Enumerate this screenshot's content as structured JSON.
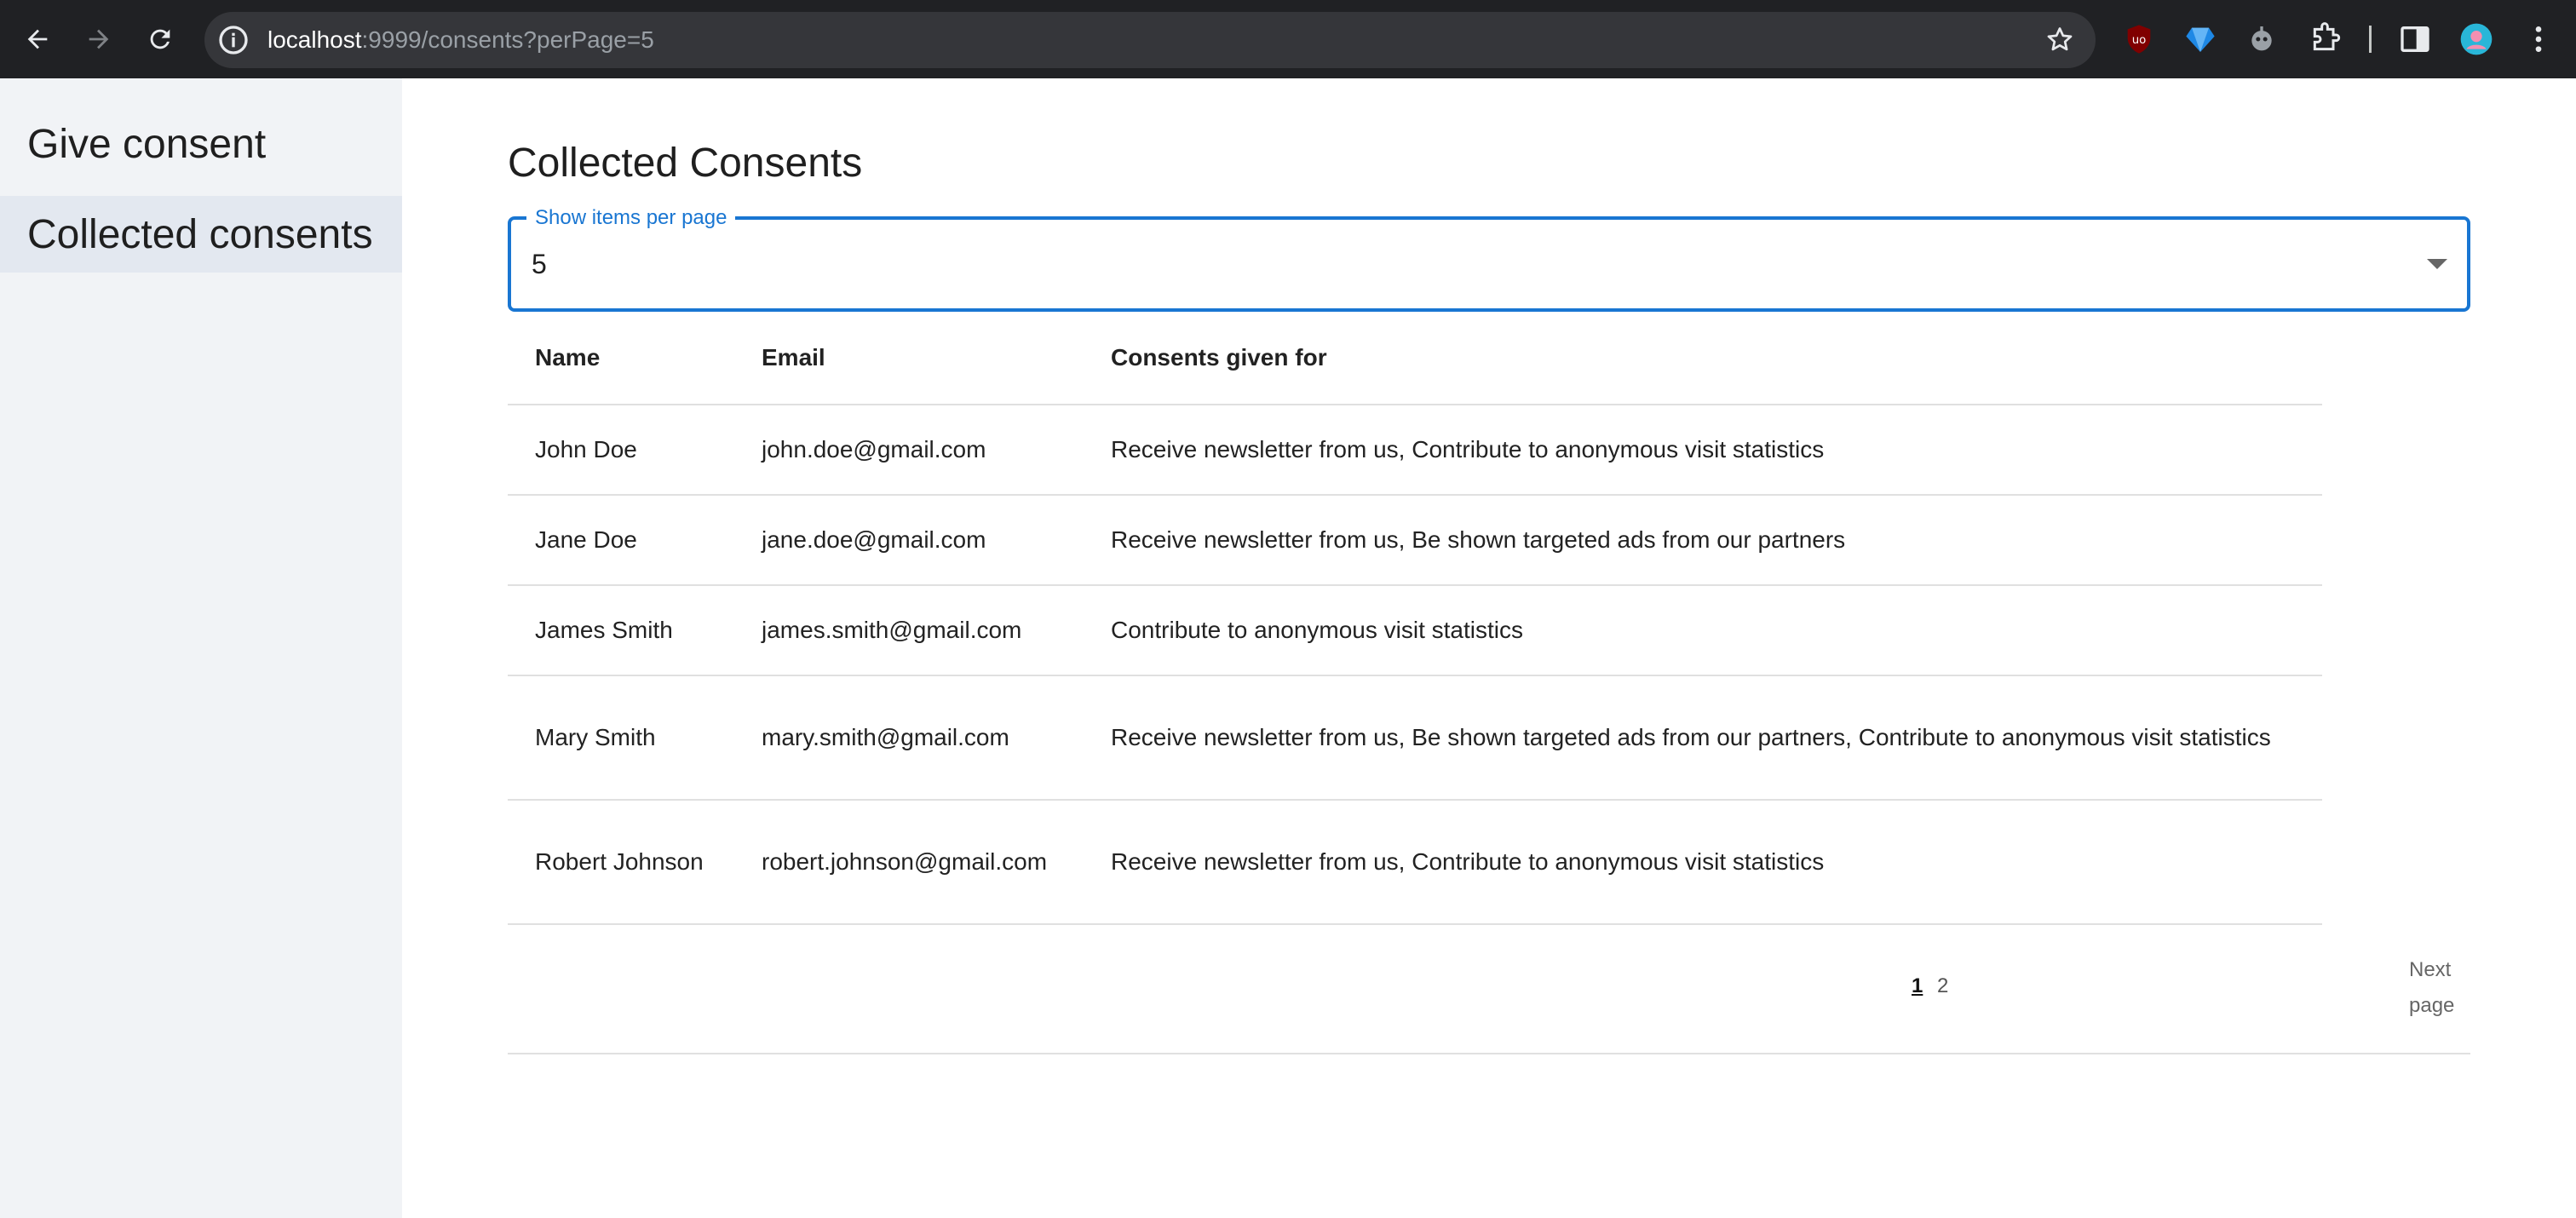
{
  "browser": {
    "url_host": "localhost",
    "url_path": ":9999/consents?perPage=5"
  },
  "sidebar": {
    "items": [
      {
        "label": "Give consent",
        "active": false
      },
      {
        "label": "Collected consents",
        "active": true
      }
    ]
  },
  "main": {
    "title": "Collected Consents",
    "per_page": {
      "label": "Show items per page",
      "value": "5"
    },
    "table": {
      "headers": [
        "Name",
        "Email",
        "Consents given for"
      ],
      "rows": [
        {
          "name": "John Doe",
          "email": "john.doe@gmail.com",
          "consents": "Receive newsletter from us, Contribute to anonymous visit statistics"
        },
        {
          "name": "Jane Doe",
          "email": "jane.doe@gmail.com",
          "consents": "Receive newsletter from us, Be shown targeted ads from our partners"
        },
        {
          "name": "James Smith",
          "email": "james.smith@gmail.com",
          "consents": "Contribute to anonymous visit statistics"
        },
        {
          "name": "Mary Smith",
          "email": "mary.smith@gmail.com",
          "consents": "Receive newsletter from us, Be shown targeted ads from our partners, Contribute to anonymous visit statistics"
        },
        {
          "name": "Robert Johnson",
          "email": "robert.johnson@gmail.com",
          "consents": "Receive newsletter from us, Contribute to anonymous visit statistics"
        }
      ]
    },
    "pagination": {
      "pages": [
        "1",
        "2"
      ],
      "current": "1",
      "next_label": "Next page"
    }
  },
  "colors": {
    "accent": "#1976d2",
    "sidebar_bg": "#f1f3f6",
    "sidebar_active_bg": "#e3e8f0",
    "chrome_bg": "#202124"
  }
}
